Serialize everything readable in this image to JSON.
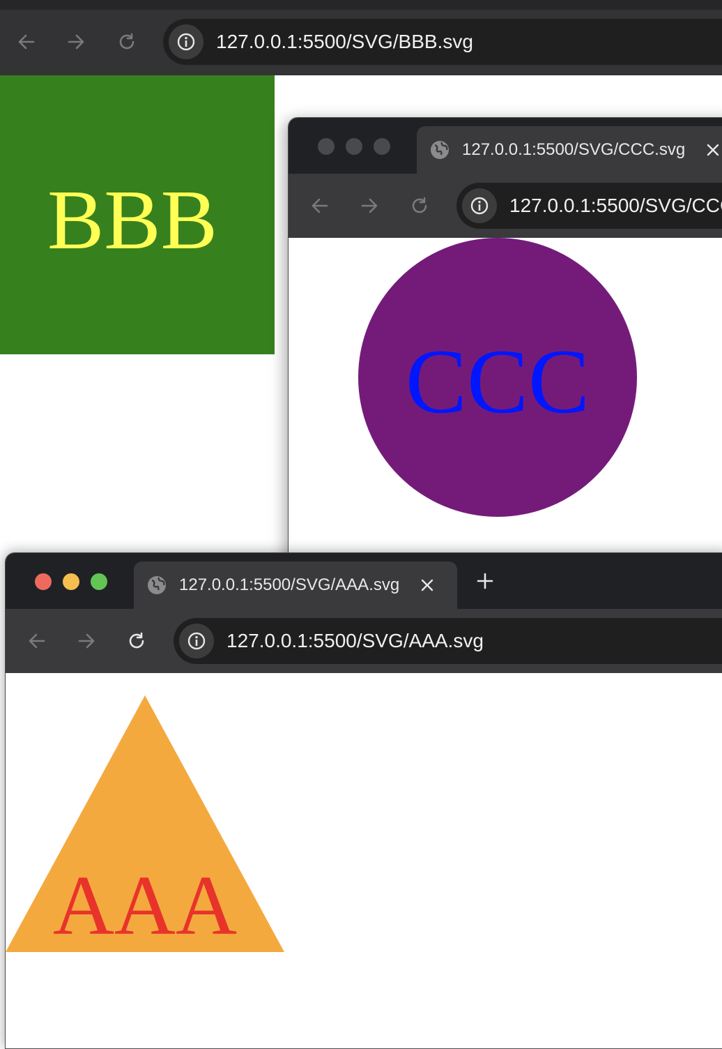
{
  "colors": {
    "bbb_fill": "#37801e",
    "bbb_text": "#ffff55",
    "ccc_fill": "#741b7a",
    "ccc_text": "#0016ff",
    "aaa_fill": "#f4a93f",
    "aaa_text": "#e8332a",
    "traffic_red": "#ee6a5f",
    "traffic_yellow": "#f5be4f",
    "traffic_green": "#62c554",
    "traffic_inactive": "#4a4a4c"
  },
  "window_bbb": {
    "url": "127.0.0.1:5500/SVG/BBB.svg",
    "svg_text": "BBB"
  },
  "window_ccc": {
    "tab_title": "127.0.0.1:5500/SVG/CCC.svg",
    "url": "127.0.0.1:5500/SVG/CCC.svg",
    "svg_text": "CCC"
  },
  "window_aaa": {
    "tab_title": "127.0.0.1:5500/SVG/AAA.svg",
    "url": "127.0.0.1:5500/SVG/AAA.svg",
    "new_tab_label": "+",
    "svg_text": "AAA"
  },
  "icons": {
    "back": "arrow-left-icon",
    "forward": "arrow-right-icon",
    "reload": "reload-icon",
    "info": "info-icon",
    "globe": "globe-icon",
    "close": "close-icon",
    "plus": "plus-icon"
  }
}
